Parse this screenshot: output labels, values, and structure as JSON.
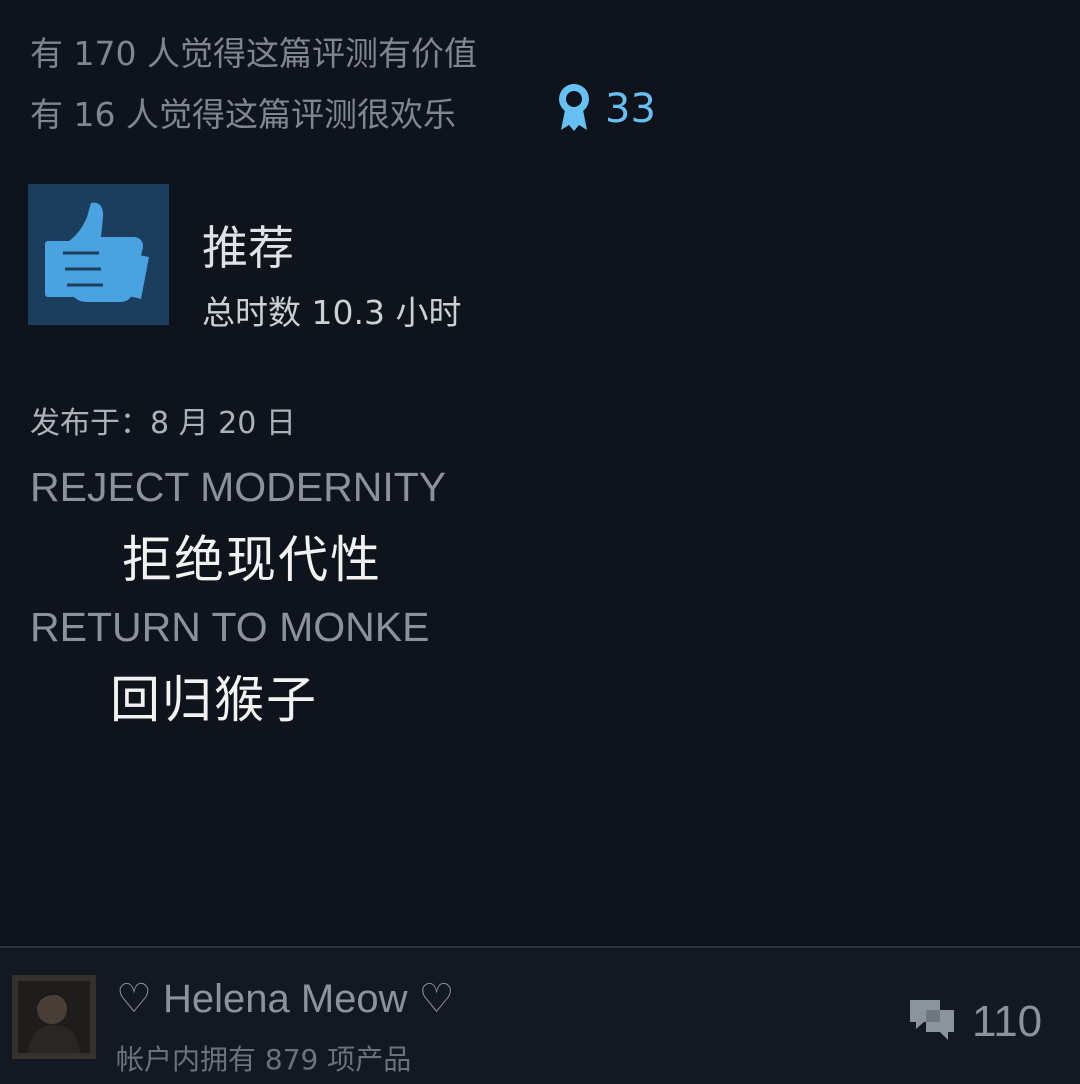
{
  "review": {
    "helpful_text": "有 170 人觉得这篇评测有价值",
    "funny_text": "有 16 人觉得这篇评测很欢乐",
    "award_icon": "award-ribbon-icon",
    "award_count": "33",
    "recommendation_icon": "thumbs-up-icon",
    "recommendation": "推荐",
    "hours": "总时数 10.3 小时",
    "posted": "发布于：8 月 20 日",
    "lines": [
      "REJECT MODERNITY",
      "拒绝现代性",
      "RETURN TO MONKE",
      "回归猴子"
    ]
  },
  "author": {
    "name": "♡ Helena Meow ♡",
    "products_owned": "帐户内拥有 879 项产品",
    "comment_icon": "comment-bubble-icon",
    "comment_count": "110"
  },
  "colors": {
    "background": "#0f141c",
    "accent_blue": "#66c0f4",
    "thumb_box": "#1a3e5c"
  }
}
